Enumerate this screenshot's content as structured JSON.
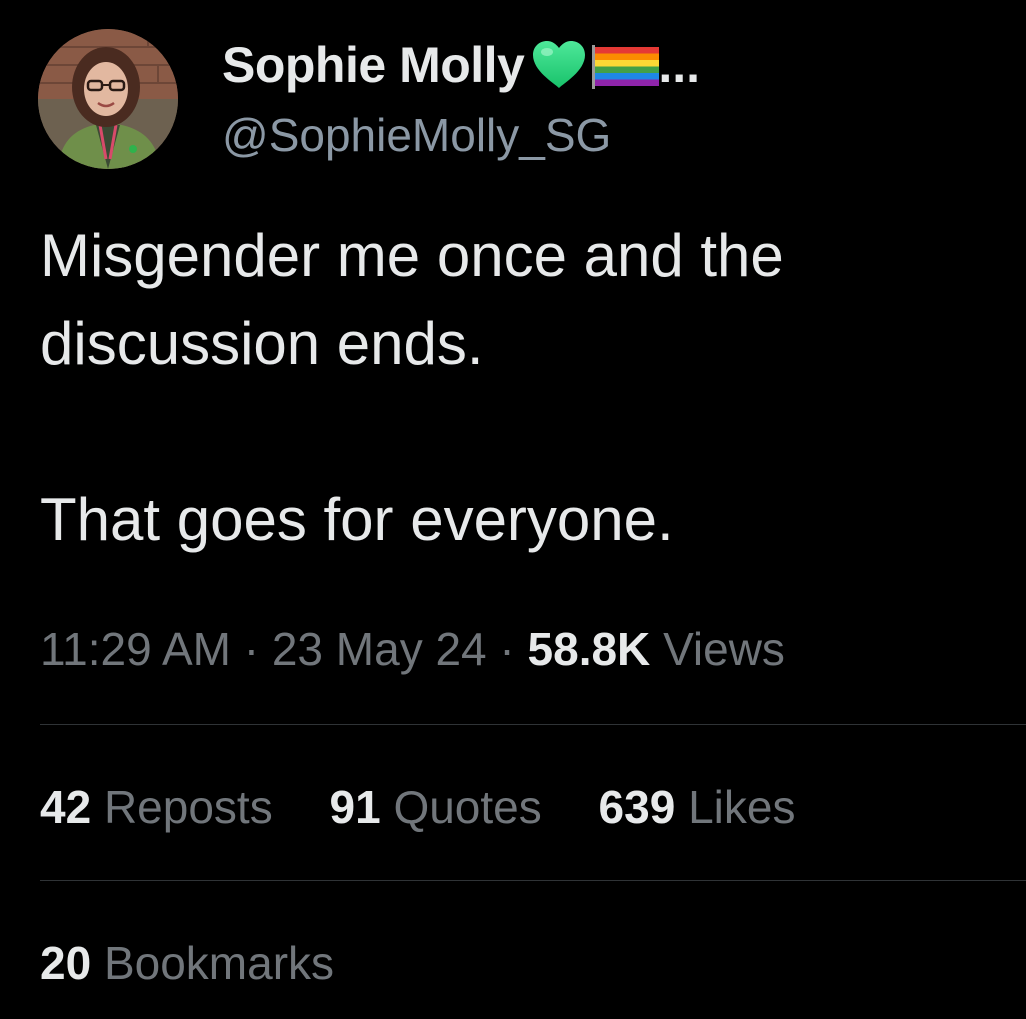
{
  "author": {
    "display_name": "Sophie Molly",
    "name_emojis": [
      "green-heart-icon",
      "rainbow-flag-icon"
    ],
    "truncation": "...",
    "handle": "@SophieMolly_SG"
  },
  "tweet": {
    "lines": [
      "Misgender me once and the",
      "discussion ends.",
      "",
      "That goes for everyone."
    ]
  },
  "meta": {
    "time": "11:29 AM",
    "separator": "·",
    "date": "23 May 24",
    "views_count": "58.8K",
    "views_label": "Views"
  },
  "stats": {
    "reposts": {
      "count": "42",
      "label": "Reposts"
    },
    "quotes": {
      "count": "91",
      "label": "Quotes"
    },
    "likes": {
      "count": "639",
      "label": "Likes"
    },
    "bookmarks": {
      "count": "20",
      "label": "Bookmarks"
    }
  },
  "colors": {
    "background": "#000000",
    "primary_text": "#e7e9ea",
    "secondary_text": "#71767b",
    "divider": "#2f3336"
  }
}
